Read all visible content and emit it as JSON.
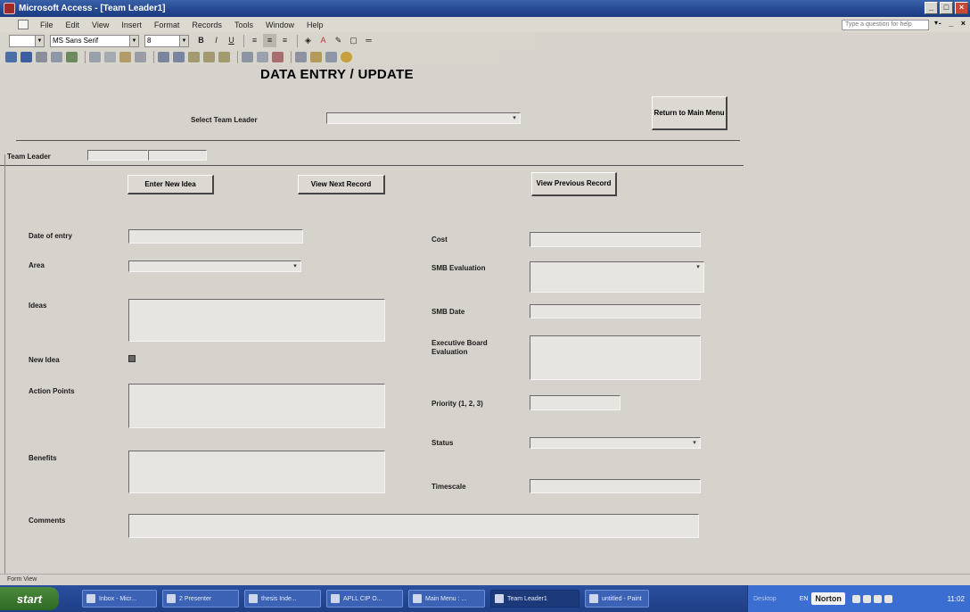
{
  "window": {
    "title": "Microsoft Access - [Team Leader1]",
    "controls": {
      "minimize": "_",
      "maximize": "□",
      "close": "×"
    }
  },
  "menubar": {
    "items": [
      "File",
      "Edit",
      "View",
      "Insert",
      "Format",
      "Records",
      "Tools",
      "Window",
      "Help"
    ],
    "help_placeholder": "Type a question for help",
    "doc_controls": "- _ ×"
  },
  "toolbar_format": {
    "font_name": "MS Sans Serif",
    "font_size": "8",
    "buttons": [
      "B",
      "I",
      "U"
    ],
    "icons": [
      "align-left-icon",
      "align-center-icon",
      "align-right-icon",
      "fill-color-icon",
      "font-color-icon",
      "line-color-icon",
      "border-icon",
      "line-width-icon"
    ]
  },
  "toolbar_form": {
    "icons": [
      "view-icon",
      "save-icon",
      "print-icon",
      "print-preview-icon",
      "spelling-icon",
      "cut-icon",
      "copy-icon",
      "paste-icon",
      "undo-icon",
      "sort-ascending-icon",
      "sort-descending-icon",
      "filter-by-selection-icon",
      "filter-by-form-icon",
      "apply-filter-icon",
      "find-icon",
      "new-record-icon",
      "delete-record-icon",
      "properties-icon",
      "database-window-icon",
      "new-object-icon",
      "help-icon"
    ]
  },
  "form": {
    "heading": "DATA ENTRY  /  UPDATE",
    "select_team_leader_label": "Select Team Leader",
    "return_button": "Return to Main Menu",
    "team_leader_label": "Team Leader",
    "buttons": {
      "enter_new_idea": "Enter New Idea",
      "view_next": "View Next Record",
      "view_previous": "View Previous Record"
    },
    "labels": {
      "date_of_entry": "Date of entry",
      "area": "Area",
      "ideas": "Ideas",
      "new_idea": "New Idea",
      "action_points": "Action Points",
      "benefits": "Benefits",
      "comments": "Comments",
      "cost": "Cost",
      "smb_evaluation": "SMB Evaluation",
      "smb_date": "SMB Date",
      "executive_board_evaluation": "Executive Board Evaluation",
      "priority": "Priority (1, 2, 3)",
      "status": "Status",
      "timescale": "Timescale"
    }
  },
  "statusbar": {
    "text": "Form View"
  },
  "taskbar": {
    "start": "start",
    "tasks": [
      {
        "label": "Inbox - Micr...",
        "active": false
      },
      {
        "label": "2 Presenter",
        "active": false
      },
      {
        "label": "thesis Inde...",
        "active": false
      },
      {
        "label": "APLL CIP  O...",
        "active": false
      },
      {
        "label": "Main Menu : ...",
        "active": false
      },
      {
        "label": "Team Leader1",
        "active": true
      },
      {
        "label": "untitled - Paint",
        "active": false
      }
    ],
    "tray": {
      "desktop": "Desktop",
      "lang": "EN",
      "norton": "Norton",
      "clock": "11:02"
    }
  }
}
